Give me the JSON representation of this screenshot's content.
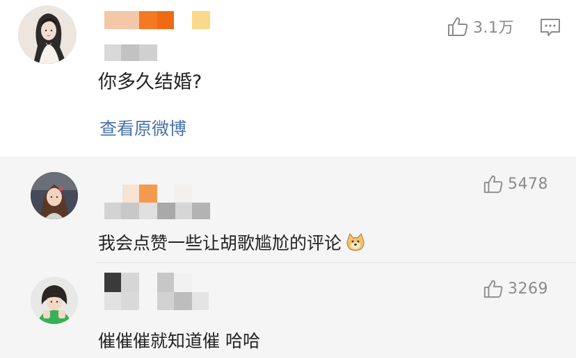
{
  "main_comment": {
    "content": "你多久结婚?",
    "like_count": "3.1万",
    "view_original_label": "查看原微博",
    "avatar_icon": "avatar-woman-illustration",
    "like_icon": "thumbs-up-icon",
    "reply_icon": "comment-icon"
  },
  "replies": [
    {
      "content": "我会点赞一些让胡歌尴尬的评论",
      "emoji_icon": "doge-emoji-icon",
      "like_count": "5478",
      "like_icon": "thumbs-up-icon"
    },
    {
      "content": "催催催就知道催 哈哈",
      "like_count": "3269",
      "like_icon": "thumbs-up-icon"
    }
  ]
}
